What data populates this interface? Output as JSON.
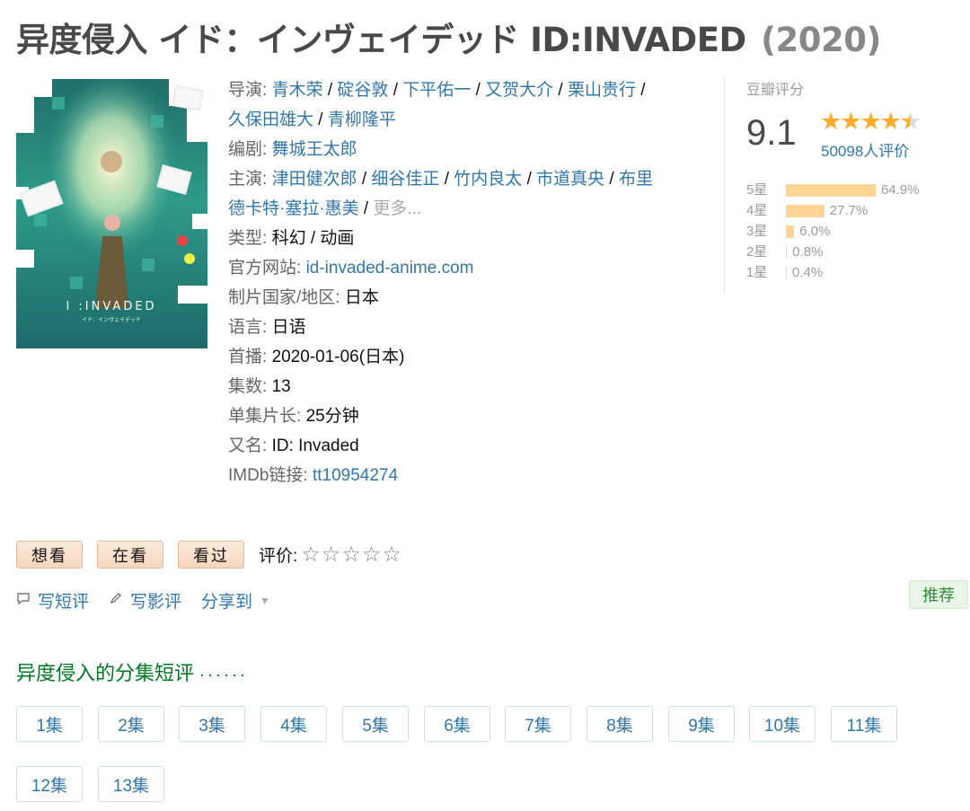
{
  "title": {
    "name": "异度侵入 イド：インヴェイデッド ID:INVADED",
    "year": "(2020)"
  },
  "poster": {
    "logo_text": "I :INVADED",
    "logo_sub": "イド：インヴェイデッド"
  },
  "info": {
    "director_label": "导演:",
    "directors": [
      "青木荣",
      "碇谷敦",
      "下平佑一",
      "又贺大介",
      "栗山贵行",
      "久保田雄大",
      "青柳隆平"
    ],
    "writer_label": "编剧:",
    "writer": "舞城王太郎",
    "cast_label": "主演:",
    "cast": [
      "津田健次郎",
      "细谷佳正",
      "竹内良太",
      "市道真央",
      "布里德卡特·塞拉·惠美"
    ],
    "more": "更多...",
    "genre_label": "类型:",
    "genre": "科幻 / 动画",
    "site_label": "官方网站:",
    "site": "id-invaded-anime.com",
    "country_label": "制片国家/地区:",
    "country": "日本",
    "lang_label": "语言:",
    "lang": "日语",
    "premiere_label": "首播:",
    "premiere": "2020-01-06(日本)",
    "episodes_label": "集数:",
    "episodes": "13",
    "runtime_label": "单集片长:",
    "runtime": "25分钟",
    "aka_label": "又名:",
    "aka": "ID: Invaded",
    "imdb_label": "IMDb链接:",
    "imdb": "tt10954274"
  },
  "rating": {
    "label": "豆瓣评分",
    "score": "9.1",
    "stars": 4.5,
    "votes": "50098人评价",
    "breakdown": [
      {
        "label": "5星",
        "pct": "64.9%",
        "value": 64.9
      },
      {
        "label": "4星",
        "pct": "27.7%",
        "value": 27.7
      },
      {
        "label": "3星",
        "pct": "6.0%",
        "value": 6.0
      },
      {
        "label": "2星",
        "pct": "0.8%",
        "value": 0.8
      },
      {
        "label": "1星",
        "pct": "0.4%",
        "value": 0.4
      }
    ]
  },
  "actions": {
    "want": "想看",
    "doing": "在看",
    "done": "看过",
    "rate_label": "评价:",
    "rate_stars": "☆☆☆☆☆"
  },
  "tools": {
    "short_review": "写短评",
    "review": "写影评",
    "share": "分享到",
    "recommend": "推荐"
  },
  "episodes_section": {
    "title": "异度侵入的分集短评",
    "dots": "······",
    "items": [
      "1集",
      "2集",
      "3集",
      "4集",
      "5集",
      "6集",
      "7集",
      "8集",
      "9集",
      "10集",
      "11集",
      "12集",
      "13集"
    ]
  },
  "colors": {
    "link": "#3377aa",
    "green": "#007722",
    "star": "#ffac2d",
    "bar": "#ffd596"
  }
}
